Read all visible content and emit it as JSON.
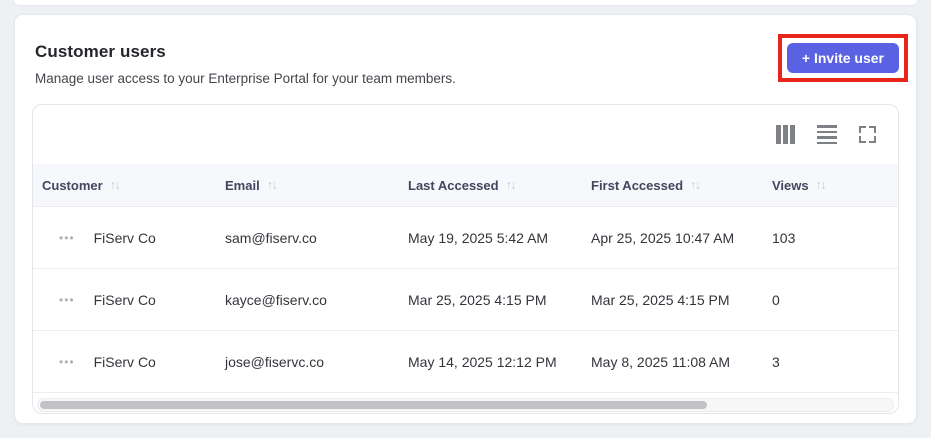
{
  "colors": {
    "page_bg": "#eef1f4",
    "accent": "#5a62e3",
    "annotation": "#e8251a",
    "header_bg": "#f7f8fb"
  },
  "card": {
    "title": "Customer users",
    "subtitle": "Manage user access to your Enterprise Portal for your team members.",
    "invite_button_label": "+ Invite user"
  },
  "toolbar": {
    "icons": [
      "columns-icon",
      "rows-icon",
      "expand-icon"
    ]
  },
  "table": {
    "sort_glyph": "↑↓",
    "row_menu_glyph": "•••",
    "columns": [
      {
        "label": "Customer"
      },
      {
        "label": "Email"
      },
      {
        "label": "Last Accessed"
      },
      {
        "label": "First Accessed"
      },
      {
        "label": "Views"
      }
    ],
    "rows": [
      {
        "customer": "FiServ Co",
        "email": "sam@fiserv.co",
        "last_accessed": "May 19, 2025 5:42 AM",
        "first_accessed": "Apr 25, 2025 10:47 AM",
        "views": "103"
      },
      {
        "customer": "FiServ Co",
        "email": "kayce@fiserv.co",
        "last_accessed": "Mar 25, 2025 4:15 PM",
        "first_accessed": "Mar 25, 2025 4:15 PM",
        "views": "0"
      },
      {
        "customer": "FiServ Co",
        "email": "jose@fiservc.co",
        "last_accessed": "May 14, 2025 12:12 PM",
        "first_accessed": "May 8, 2025 11:08 AM",
        "views": "3"
      }
    ]
  }
}
